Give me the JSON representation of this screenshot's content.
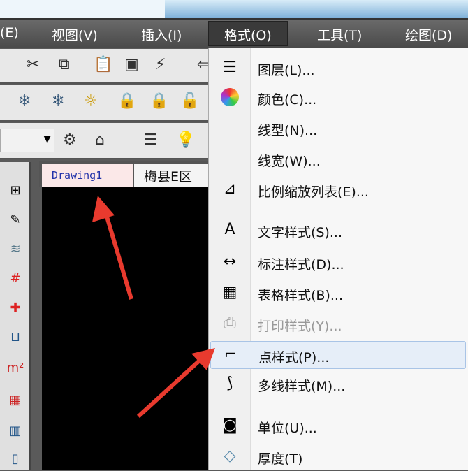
{
  "menubar": {
    "items": [
      "(E)",
      "视图(V)",
      "插入(I)",
      "格式(O)",
      "工具(T)",
      "绘图(D)"
    ],
    "active": "格式(O)"
  },
  "tabs": {
    "drawing": "Drawing1",
    "other": "梅县E区"
  },
  "format_menu": {
    "items": [
      {
        "label": "图层(L)...",
        "icon": "layer-icon"
      },
      {
        "label": "颜色(C)...",
        "icon": "color-wheel-icon"
      },
      {
        "label": "线型(N)...",
        "icon": ""
      },
      {
        "label": "线宽(W)...",
        "icon": ""
      },
      {
        "label": "比例缩放列表(E)...",
        "icon": "scale-list-icon"
      },
      {
        "label": "文字样式(S)...",
        "icon": "text-style-icon"
      },
      {
        "label": "标注样式(D)...",
        "icon": "dimension-style-icon"
      },
      {
        "label": "表格样式(B)...",
        "icon": "table-style-icon"
      },
      {
        "label": "打印样式(Y)...",
        "icon": "print-style-icon",
        "disabled": true
      },
      {
        "label": "点样式(P)...",
        "icon": "point-style-icon",
        "highlighted": true
      },
      {
        "label": "多线样式(M)...",
        "icon": "multiline-style-icon"
      },
      {
        "label": "单位(U)...",
        "icon": "units-icon"
      },
      {
        "label": "厚度(T)",
        "icon": "thickness-icon"
      }
    ]
  },
  "colors": {
    "arrow": "#e83a2e",
    "highlight": "#e6eef8"
  }
}
